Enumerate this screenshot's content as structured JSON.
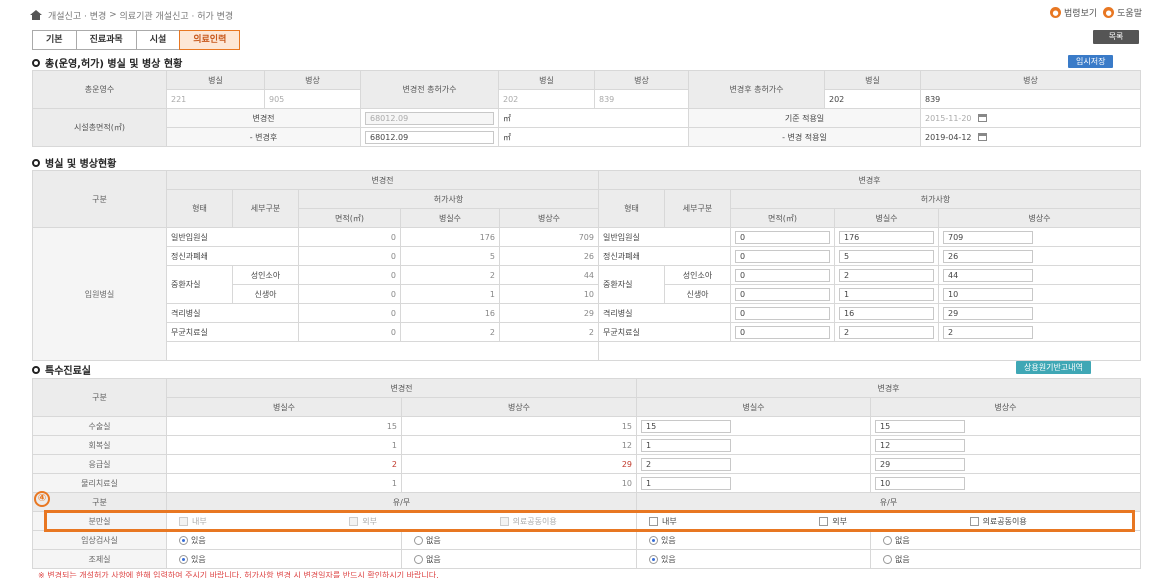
{
  "breadcrumb": [
    "개설신고 · 변경",
    "의료기관 개설신고 · 허가 변경"
  ],
  "top_buttons": [
    {
      "label": "법령보기",
      "icon": "circle"
    },
    {
      "label": "도움말",
      "icon": "circle"
    }
  ],
  "tabs": [
    "기본",
    "진료과목",
    "시설",
    "의료인력"
  ],
  "active_tab": 3,
  "list_button": "목록",
  "section1": {
    "title": "총(운영,허가) 병실 및 병상 현황",
    "save_button": "임시저장",
    "row1": {
      "label": "총운영수",
      "h_room": "병실",
      "h_bed": "병상",
      "before_room": "221",
      "before_bed": "905",
      "before_label": "변경전 총허가수",
      "before_total_room": "202",
      "before_total_bed": "839",
      "after_label": "변경후 총허가수",
      "after_room": "202",
      "after_bed": "839"
    },
    "row2": {
      "label": "시설총면적(㎡)",
      "before_label": "변경전",
      "before_value": "68012.09",
      "unit": "㎡",
      "after_label": "- 변경후",
      "after_value": "68012.09",
      "base_date_label": "기준 적용일",
      "base_date": "2015-11-20",
      "change_date_label": "- 변경 적용일",
      "change_date": "2019-04-12"
    }
  },
  "section2": {
    "title": "병실 및 병상현황",
    "h_gubun": "구분",
    "h_before": "변경전",
    "h_after": "변경후",
    "h_type": "형태",
    "h_detail": "세부구분",
    "h_permit": "허가사항",
    "h_area": "면적(㎡)",
    "h_rooms": "병실수",
    "h_beds": "병상수",
    "group_label": "입원병실",
    "rows": [
      {
        "type": "일반입원실",
        "detail": "",
        "b_area": "0",
        "b_rooms": "176",
        "b_beds": "709",
        "a_area": "0",
        "a_rooms": "176",
        "a_beds": "709"
      },
      {
        "type": "정신과폐쇄",
        "detail": "",
        "b_area": "0",
        "b_rooms": "5",
        "b_beds": "26",
        "a_area": "0",
        "a_rooms": "5",
        "a_beds": "26"
      },
      {
        "type": "중환자실",
        "detail": "성인소아",
        "b_area": "0",
        "b_rooms": "2",
        "b_beds": "44",
        "a_area": "0",
        "a_rooms": "2",
        "a_beds": "44"
      },
      {
        "type": "",
        "detail": "신생아",
        "b_area": "0",
        "b_rooms": "1",
        "b_beds": "10",
        "a_area": "0",
        "a_rooms": "1",
        "a_beds": "10"
      },
      {
        "type": "격리병실",
        "detail": "",
        "b_area": "0",
        "b_rooms": "16",
        "b_beds": "29",
        "a_area": "0",
        "a_rooms": "16",
        "a_beds": "29"
      },
      {
        "type": "무균치료실",
        "detail": "",
        "b_area": "0",
        "b_rooms": "2",
        "b_beds": "2",
        "a_area": "0",
        "a_rooms": "2",
        "a_beds": "2"
      }
    ]
  },
  "section3": {
    "title": "특수진료실",
    "side_button": "상용원기반고내역",
    "h_gubun": "구분",
    "h_before": "변경전",
    "h_after": "변경후",
    "h_rooms": "병실수",
    "h_beds": "병상수",
    "rows": [
      {
        "label": "수술실",
        "b_rooms": "15",
        "b_beds": "15",
        "a_rooms": "15",
        "a_beds": "15",
        "red": false
      },
      {
        "label": "회복실",
        "b_rooms": "1",
        "b_beds": "12",
        "a_rooms": "1",
        "a_beds": "12",
        "red": false
      },
      {
        "label": "응급실",
        "b_rooms": "2",
        "b_beds": "29",
        "a_rooms": "2",
        "a_beds": "29",
        "red": true
      },
      {
        "label": "물리치료실",
        "b_rooms": "1",
        "b_beds": "10",
        "a_rooms": "1",
        "a_beds": "10",
        "red": false
      }
    ],
    "marker": "④",
    "yn_label": "유/무",
    "delivery": {
      "label": "분만실",
      "opts": [
        "내부",
        "외부",
        "의료공동이용"
      ]
    },
    "lab": {
      "label": "임상검사실",
      "yes": "있음",
      "no": "없음"
    },
    "xray": {
      "label": "조제실",
      "yes": "있음",
      "no": "없음"
    }
  },
  "footnote": "※ 변경되는 개설허가 사항에 한해 입력하여 주시기 바랍니다. 허가사항 변경 시 변경일자를 반드시 확인하시기 바랍니다."
}
